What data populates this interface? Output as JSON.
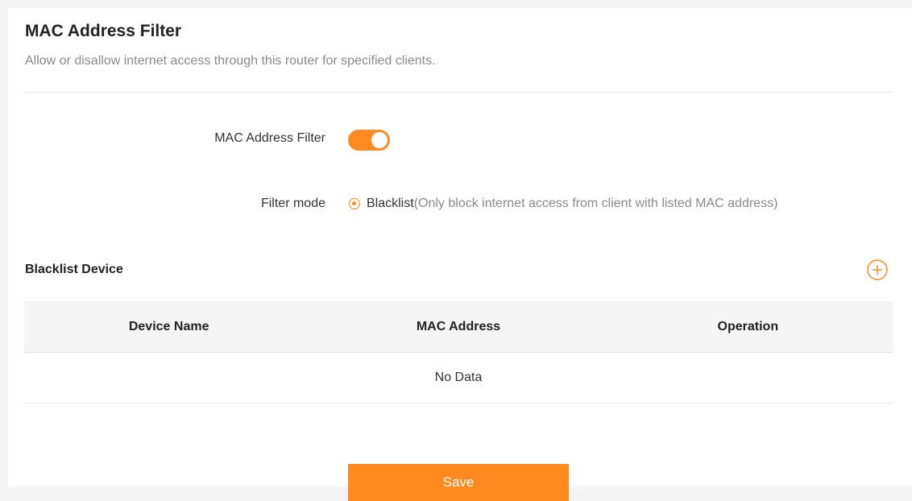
{
  "header": {
    "title": "MAC Address Filter",
    "description": "Allow or disallow internet access through this router for specified clients."
  },
  "settings": {
    "filter_label": "MAC Address Filter",
    "filter_enabled": true,
    "mode_label": "Filter mode",
    "mode_option_main": "Blacklist",
    "mode_option_sub": "(Only block internet access from client with listed MAC address)"
  },
  "device_list": {
    "title": "Blacklist Device",
    "columns": [
      "Device Name",
      "MAC Address",
      "Operation"
    ],
    "empty_text": "No Data"
  },
  "actions": {
    "save_label": "Save"
  },
  "colors": {
    "accent": "#ff8a1f"
  }
}
